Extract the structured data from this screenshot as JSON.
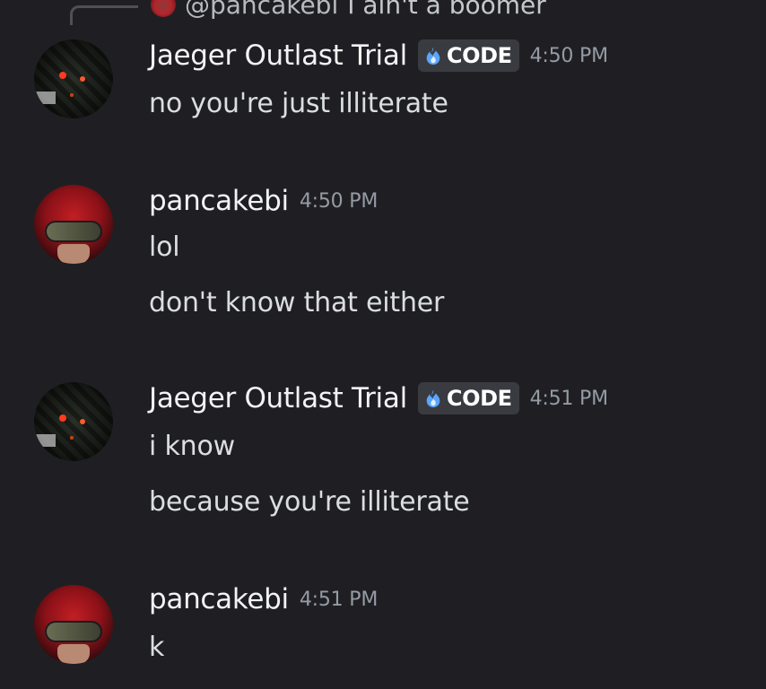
{
  "reply": {
    "username": "@pancakebi",
    "text": "I ain't a boomer"
  },
  "messages": [
    {
      "username": "Jaeger Outlast Trial",
      "tag": "CODE",
      "timestamp": "4:50 PM",
      "lines": [
        "no you're just illiterate"
      ]
    },
    {
      "username": "pancakebi",
      "timestamp": "4:50 PM",
      "lines": [
        "lol",
        "don't know that either"
      ]
    },
    {
      "username": "Jaeger Outlast Trial",
      "tag": "CODE",
      "timestamp": "4:51 PM",
      "lines": [
        "i know",
        "because you're illiterate"
      ]
    },
    {
      "username": "pancakebi",
      "timestamp": "4:51 PM",
      "lines": [
        "k"
      ]
    }
  ],
  "colors": {
    "background": "#1f1f23",
    "username": "#f2f3f5",
    "timestamp": "#949ba4",
    "tag_bg": "#3a3b41",
    "tag_icon": "#5aa6ff"
  },
  "icons": {
    "tag_icon": "blue-flame-icon",
    "reply_connector": "reply-spine-icon"
  }
}
